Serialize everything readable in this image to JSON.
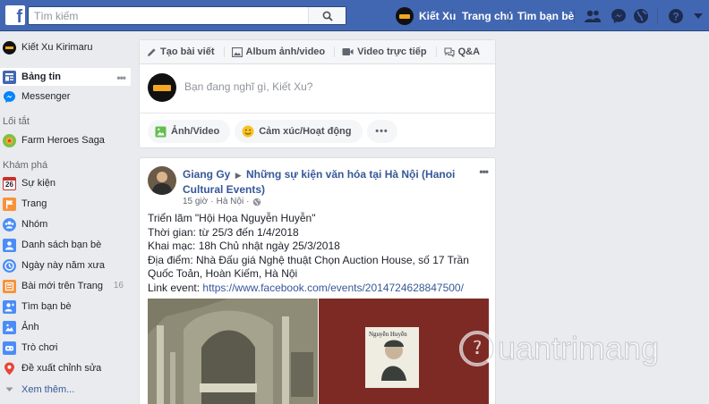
{
  "topbar": {
    "logo": "f",
    "search_placeholder": "Tìm kiếm",
    "user_name": "Kiết Xu",
    "home_label": "Trang chủ",
    "find_friends_label": "Tìm bạn bè"
  },
  "sidebar": {
    "profile_name": "Kiết Xu Kirimaru",
    "items_main": [
      {
        "label": "Bảng tin",
        "icon": "news-feed-icon"
      },
      {
        "label": "Messenger",
        "icon": "messenger-icon"
      }
    ],
    "shortcuts_heading": "Lối tắt",
    "shortcuts": [
      {
        "label": "Farm Heroes Saga",
        "icon": "game-icon"
      }
    ],
    "explore_heading": "Khám phá",
    "explore": [
      {
        "label": "Sự kiện",
        "icon": "calendar-icon",
        "icon_text": "26"
      },
      {
        "label": "Trang",
        "icon": "flag-icon"
      },
      {
        "label": "Nhóm",
        "icon": "groups-icon"
      },
      {
        "label": "Danh sách bạn bè",
        "icon": "friend-list-icon"
      },
      {
        "label": "Ngày này năm xưa",
        "icon": "memories-icon"
      },
      {
        "label": "Bài mới trên Trang",
        "icon": "pages-feed-icon",
        "count": "16"
      },
      {
        "label": "Tìm bạn bè",
        "icon": "find-friends-icon"
      },
      {
        "label": "Ảnh",
        "icon": "photos-icon"
      },
      {
        "label": "Trò chơi",
        "icon": "games-icon"
      },
      {
        "label": "Đề xuất chỉnh sửa",
        "icon": "suggest-edits-icon"
      }
    ],
    "see_more": "Xem thêm..."
  },
  "composer": {
    "tabs": [
      {
        "label": "Tạo bài viết",
        "icon": "pencil-icon"
      },
      {
        "label": "Album ảnh/video",
        "icon": "album-icon"
      },
      {
        "label": "Video trực tiếp",
        "icon": "live-video-icon"
      },
      {
        "label": "Q&A",
        "icon": "qa-icon"
      }
    ],
    "placeholder": "Bạn đang nghĩ gì, Kiết Xu?",
    "actions": [
      {
        "label": "Ảnh/Video",
        "icon": "photo-icon"
      },
      {
        "label": "Cảm xúc/Hoạt động",
        "icon": "feeling-icon"
      }
    ],
    "more": "•••"
  },
  "post": {
    "author": "Giang Gy",
    "page": "Những sự kiện văn hóa tại Hà Nội (Hanoi Cultural Events)",
    "time": "15 giờ",
    "location": "Hà Nội",
    "lines": [
      "Triển lãm \"Hội Họa Nguyễn Huyễn\"",
      "Thời gian: từ 25/3 đến 1/4/2018",
      "Khai mạc: 18h Chủ nhật ngày 25/3/2018",
      "Địa điểm: Nhà Đấu giá Nghệ thuật Chọn Auction House, số 17 Trần Quốc Toản, Hoàn Kiếm, Hà Nội"
    ],
    "link_label": "Link event:",
    "link_url": "https://www.facebook.com/events/2014724628847500/",
    "image_caption": "Nguyễn Huyễn"
  },
  "watermark": "uantrimang",
  "colors": {
    "brand": "#4267b2",
    "link": "#365899",
    "background": "#e9ebee"
  }
}
